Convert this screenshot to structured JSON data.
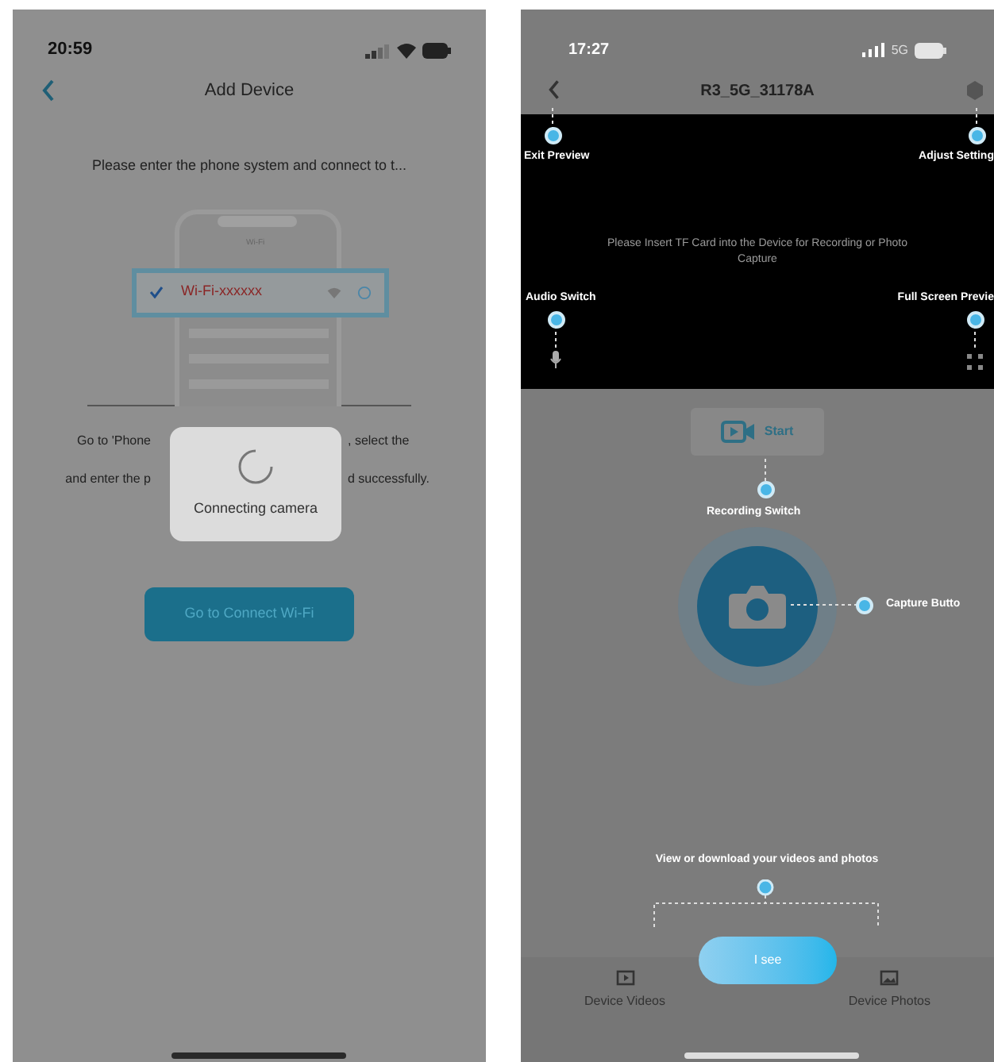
{
  "left_screen": {
    "status_bar": {
      "time": "20:59"
    },
    "header": {
      "title": "Add Device"
    },
    "prompt": "Please enter the phone system and connect to t...",
    "illustration": {
      "screen_title": "Wi-Fi",
      "network": "Wi-Fi-xxxxxx",
      "checked": true
    },
    "instructions": [
      {
        "left": "Go to 'Phone",
        "right": ", select the"
      },
      {
        "left": "and enter the p",
        "right": "d successfully."
      }
    ],
    "loading_dialog": {
      "message": "Connecting camera"
    },
    "primary_button": "Go to Connect Wi-Fi"
  },
  "right_screen": {
    "status_bar": {
      "time": "17:27",
      "network": "5G"
    },
    "header": {
      "title": "R3_5G_31178A"
    },
    "preview": {
      "message": "Please Insert TF Card into the Device for Recording or Photo Capture"
    },
    "record_button": "Start",
    "bottom_tabs": [
      {
        "label": "Device Videos"
      },
      {
        "label": "Device Photos"
      }
    ],
    "tutorial": {
      "callouts": [
        {
          "label": "Exit Preview"
        },
        {
          "label": "Adjust Setting"
        },
        {
          "label": "Audio Switch"
        },
        {
          "label": "Full Screen Previe"
        },
        {
          "label": "Recording Switch"
        },
        {
          "label": "Capture Butto"
        }
      ],
      "hint": "View or download your videos and photos",
      "dismiss_button": "I see"
    }
  }
}
